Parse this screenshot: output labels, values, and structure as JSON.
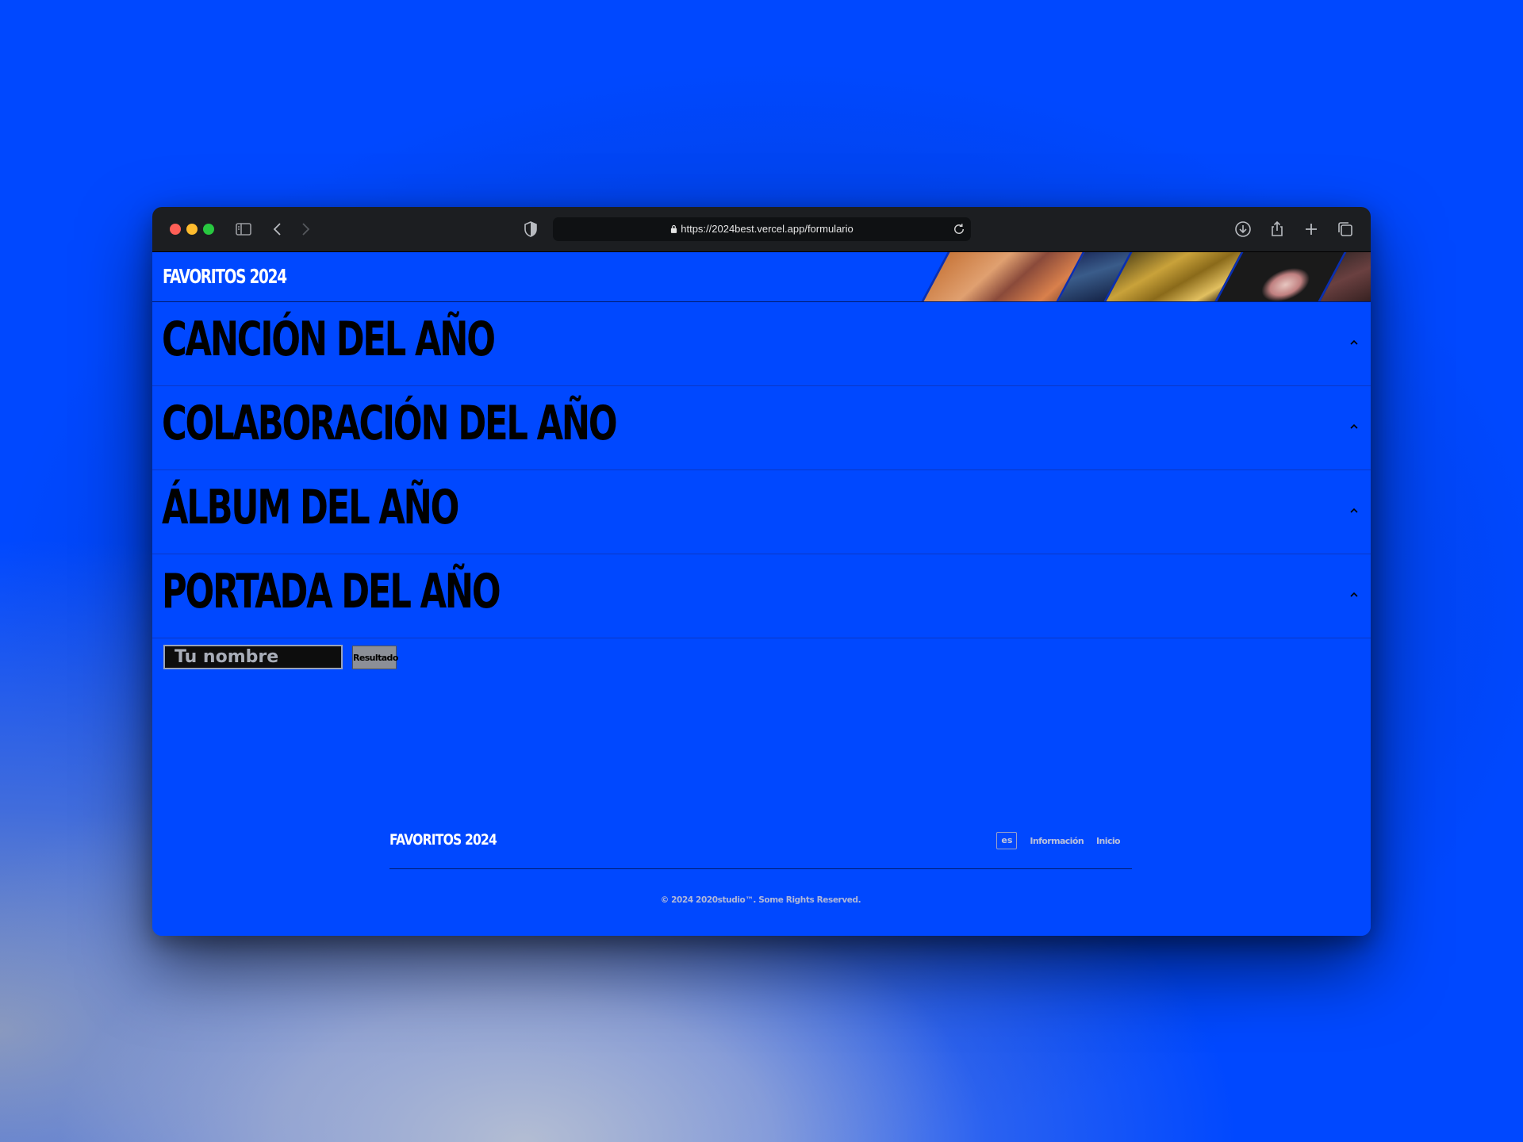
{
  "browser": {
    "url": "https://2024best.vercel.app/formulario",
    "icons": {
      "sidebar": "sidebar-icon",
      "back": "chevron-left-icon",
      "forward": "chevron-right-icon",
      "shield": "shield-icon",
      "lock": "lock-icon",
      "reload": "reload-icon",
      "download": "download-icon",
      "share": "share-icon",
      "new_tab": "plus-icon",
      "tabs": "tabs-overview-icon"
    }
  },
  "header": {
    "brand": "FAVORITOS 2024"
  },
  "accordion": [
    {
      "title": "CANCIÓN DEL AÑO"
    },
    {
      "title": "COLABORACIÓN DEL AÑO"
    },
    {
      "title": "ÁLBUM DEL AÑO"
    },
    {
      "title": "PORTADA DEL AÑO"
    }
  ],
  "form": {
    "name_placeholder": "Tu nombre",
    "submit_label": "Resultado"
  },
  "footer": {
    "brand": "FAVORITOS 2024",
    "lang": "es",
    "links": [
      "Información",
      "Inicio"
    ],
    "copyright": "© 2024 2020studio™. Some Rights Reserved."
  },
  "colors": {
    "page_background": "#0048ff",
    "title_text": "#000000",
    "brand_text": "#ffffff",
    "browser_chrome": "#1c1e21"
  }
}
